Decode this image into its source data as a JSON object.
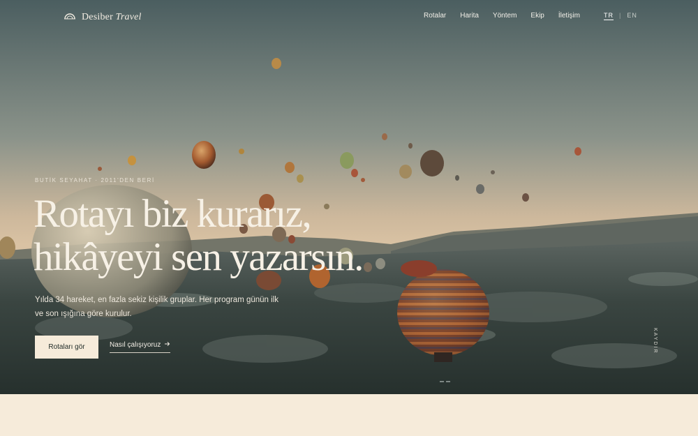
{
  "brand": {
    "name": "Desiber",
    "suffix": "Travel",
    "icon": "arch-logo-icon"
  },
  "nav": {
    "items": [
      "Rotalar",
      "Harita",
      "Yöntem",
      "Ekip",
      "İletişim"
    ]
  },
  "lang": {
    "active": "TR",
    "other": "EN",
    "separator": "|"
  },
  "hero": {
    "eyebrow": "BUTİK SEYAHAT · 2011'DEN BERİ",
    "headline_line1": "Rotayı biz kurarız,",
    "headline_line2": "hikâyeyi sen yazarsın.",
    "lead": "Yılda 34 hareket, en fazla sekiz kişilik gruplar. Her program günün ilk ve son ışığına göre kurulur.",
    "primary_button": "Rotaları gör",
    "secondary_link": "Nasıl çalışıyoruz",
    "secondary_icon": "arrow-right-icon",
    "scroll_label": "KAYDIR"
  },
  "colors": {
    "accent_bg": "#f6ebda",
    "text_light": "#f7f1e6"
  }
}
